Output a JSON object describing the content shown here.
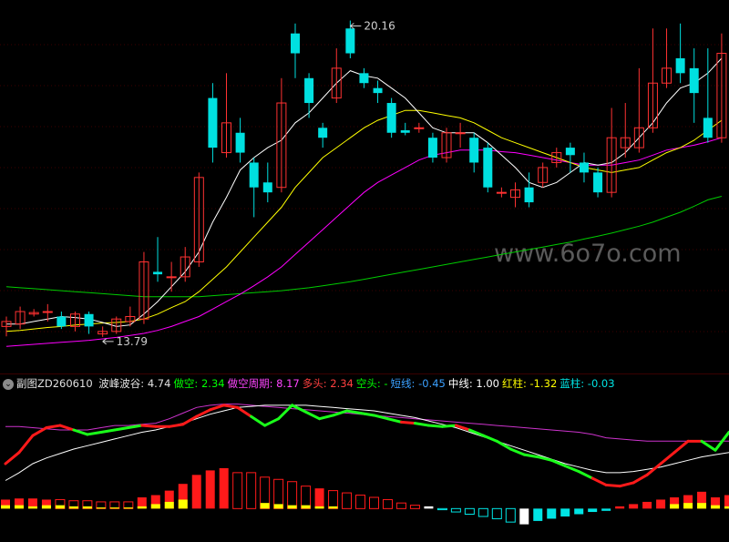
{
  "colors": {
    "up": "#ff3232",
    "down": "#00e0e0",
    "ma5": "#ffffff",
    "ma10": "#ffff00",
    "ma20": "#ff00ff",
    "ma60": "#00cc00",
    "red_bar": "#ff1a1a",
    "yellow_bar": "#ffff00",
    "cyan_bar": "#00e5e5",
    "white_bar": "#ffffff"
  },
  "main": {
    "high_label": "20.16",
    "low_label": "13.79",
    "watermark": "www.6o7o.com"
  },
  "indicator": {
    "title": "副图ZD260610",
    "fields": [
      {
        "label": "波峰波谷:",
        "value": "4.74",
        "color": "#e0e0e0"
      },
      {
        "label": "做空:",
        "value": "2.34",
        "color": "#00ff00"
      },
      {
        "label": "做空周期:",
        "value": "8.17",
        "color": "#ff44ff"
      },
      {
        "label": "多头:",
        "value": "2.34",
        "color": "#ff4040"
      },
      {
        "label": "空头:",
        "value": "-",
        "color": "#00ff00"
      },
      {
        "label": "短线:",
        "value": "-0.45",
        "color": "#3aa0ff"
      },
      {
        "label": "中线:",
        "value": "1.00",
        "color": "#ffffff"
      },
      {
        "label": "红柱:",
        "value": "-1.32",
        "color": "#ffff00"
      },
      {
        "label": "蓝柱:",
        "value": "-0.03",
        "color": "#00e5e5"
      }
    ]
  },
  "chart_data": [
    {
      "type": "candlestick",
      "ylim": [
        13.2,
        20.5
      ],
      "candles": [
        [
          14.0,
          14.1,
          14.2,
          13.8
        ],
        [
          14.05,
          14.3,
          14.4,
          13.95
        ],
        [
          14.25,
          14.28,
          14.35,
          14.2
        ],
        [
          14.3,
          14.3,
          14.45,
          14.1
        ],
        [
          14.2,
          14.0,
          14.3,
          13.95
        ],
        [
          14.0,
          14.25,
          14.3,
          13.9
        ],
        [
          14.25,
          14.0,
          14.3,
          13.85
        ],
        [
          13.85,
          13.9,
          14.0,
          13.79
        ],
        [
          13.9,
          14.15,
          14.2,
          13.85
        ],
        [
          14.1,
          14.2,
          14.4,
          14.0
        ],
        [
          14.15,
          15.3,
          15.5,
          14.05
        ],
        [
          15.1,
          15.05,
          15.8,
          14.9
        ],
        [
          15.0,
          15.0,
          15.3,
          14.7
        ],
        [
          15.0,
          15.4,
          15.6,
          14.9
        ],
        [
          15.3,
          17.0,
          17.1,
          15.2
        ],
        [
          18.6,
          17.6,
          18.9,
          17.3
        ],
        [
          17.5,
          18.1,
          19.1,
          17.4
        ],
        [
          17.9,
          17.5,
          18.2,
          17.3
        ],
        [
          17.3,
          16.8,
          17.4,
          16.2
        ],
        [
          16.9,
          16.7,
          17.3,
          16.5
        ],
        [
          16.8,
          18.5,
          19.0,
          16.7
        ],
        [
          19.9,
          19.5,
          20.1,
          19.0
        ],
        [
          19.0,
          18.5,
          19.1,
          18.2
        ],
        [
          18.0,
          17.8,
          18.1,
          17.6
        ],
        [
          18.6,
          19.2,
          19.6,
          18.5
        ],
        [
          20.0,
          19.5,
          20.16,
          19.4
        ],
        [
          19.1,
          18.9,
          19.2,
          18.8
        ],
        [
          18.8,
          18.7,
          18.95,
          18.5
        ],
        [
          18.5,
          17.9,
          18.6,
          17.8
        ],
        [
          17.95,
          17.9,
          18.1,
          17.85
        ],
        [
          18.0,
          18.0,
          18.1,
          17.9
        ],
        [
          17.8,
          17.4,
          17.9,
          17.3
        ],
        [
          17.4,
          17.9,
          18.0,
          17.3
        ],
        [
          17.9,
          17.9,
          18.1,
          17.6
        ],
        [
          17.8,
          17.3,
          17.9,
          17.1
        ],
        [
          17.6,
          16.8,
          17.7,
          16.7
        ],
        [
          16.7,
          16.7,
          16.8,
          16.6
        ],
        [
          16.6,
          16.75,
          16.9,
          16.4
        ],
        [
          16.8,
          16.5,
          17.1,
          16.4
        ],
        [
          16.9,
          17.2,
          17.3,
          16.8
        ],
        [
          17.3,
          17.5,
          17.6,
          17.2
        ],
        [
          17.6,
          17.45,
          17.7,
          17.1
        ],
        [
          17.3,
          17.1,
          17.5,
          16.9
        ],
        [
          17.1,
          16.7,
          17.2,
          16.6
        ],
        [
          16.7,
          17.8,
          18.4,
          16.6
        ],
        [
          17.6,
          17.8,
          18.5,
          17.4
        ],
        [
          17.6,
          18.0,
          19.2,
          17.5
        ],
        [
          18.0,
          18.9,
          20.0,
          17.9
        ],
        [
          18.9,
          19.2,
          20.0,
          18.8
        ],
        [
          19.4,
          19.1,
          20.1,
          18.9
        ],
        [
          19.2,
          18.7,
          19.6,
          18.1
        ],
        [
          18.2,
          17.8,
          19.6,
          17.7
        ],
        [
          17.8,
          19.5,
          19.9,
          17.7
        ]
      ],
      "ma5": [
        14.05,
        14.05,
        14.1,
        14.15,
        14.2,
        14.18,
        14.15,
        14.08,
        14.0,
        14.03,
        14.25,
        14.5,
        14.8,
        15.1,
        15.5,
        16.1,
        16.6,
        17.15,
        17.4,
        17.6,
        17.75,
        18.1,
        18.3,
        18.6,
        18.9,
        19.15,
        19.05,
        19.0,
        18.8,
        18.6,
        18.3,
        18.0,
        17.9,
        17.9,
        17.9,
        17.7,
        17.45,
        17.2,
        16.9,
        16.8,
        16.9,
        17.1,
        17.3,
        17.25,
        17.3,
        17.5,
        17.8,
        18.1,
        18.5,
        18.8,
        18.9,
        19.1,
        19.4
      ],
      "ma10": [
        13.9,
        13.92,
        13.95,
        13.98,
        14.0,
        14.03,
        14.05,
        14.07,
        14.08,
        14.1,
        14.15,
        14.25,
        14.38,
        14.5,
        14.7,
        14.95,
        15.2,
        15.5,
        15.8,
        16.1,
        16.4,
        16.8,
        17.1,
        17.4,
        17.6,
        17.8,
        18.0,
        18.15,
        18.25,
        18.35,
        18.35,
        18.3,
        18.25,
        18.2,
        18.1,
        17.95,
        17.8,
        17.7,
        17.6,
        17.5,
        17.4,
        17.3,
        17.2,
        17.15,
        17.1,
        17.15,
        17.2,
        17.35,
        17.5,
        17.6,
        17.75,
        17.95,
        18.15
      ],
      "ma20": [
        13.6,
        13.62,
        13.64,
        13.66,
        13.68,
        13.7,
        13.72,
        13.75,
        13.78,
        13.82,
        13.86,
        13.92,
        14.0,
        14.1,
        14.2,
        14.35,
        14.5,
        14.65,
        14.82,
        15.0,
        15.2,
        15.45,
        15.7,
        15.95,
        16.2,
        16.45,
        16.7,
        16.9,
        17.05,
        17.2,
        17.35,
        17.45,
        17.5,
        17.55,
        17.55,
        17.55,
        17.52,
        17.5,
        17.45,
        17.4,
        17.35,
        17.3,
        17.25,
        17.25,
        17.25,
        17.3,
        17.35,
        17.45,
        17.55,
        17.6,
        17.65,
        17.72,
        17.8
      ],
      "ma60": [
        14.8,
        14.78,
        14.76,
        14.74,
        14.72,
        14.7,
        14.68,
        14.66,
        14.64,
        14.62,
        14.6,
        14.6,
        14.6,
        14.6,
        14.6,
        14.62,
        14.64,
        14.66,
        14.68,
        14.7,
        14.72,
        14.75,
        14.78,
        14.82,
        14.86,
        14.9,
        14.95,
        15.0,
        15.05,
        15.1,
        15.15,
        15.2,
        15.25,
        15.3,
        15.35,
        15.4,
        15.45,
        15.5,
        15.55,
        15.6,
        15.65,
        15.7,
        15.76,
        15.82,
        15.88,
        15.95,
        16.02,
        16.1,
        16.2,
        16.3,
        16.42,
        16.55,
        16.62
      ]
    },
    {
      "type": "line",
      "ylim": [
        -2,
        10
      ],
      "peak_line": [
        4.0,
        5.0,
        6.5,
        7.2,
        7.4,
        7.0,
        6.6,
        6.8,
        7.0,
        7.2,
        7.4,
        7.3,
        7.3,
        7.5,
        8.2,
        8.8,
        9.2,
        9.0,
        8.2,
        7.4,
        8.0,
        9.2,
        8.6,
        8.0,
        8.3,
        8.7,
        8.5,
        8.3,
        8.0,
        7.7,
        7.6,
        7.4,
        7.3,
        7.4,
        7.0,
        6.5,
        6.0,
        5.3,
        4.8,
        4.6,
        4.3,
        3.8,
        3.3,
        2.7,
        2.1,
        2.0,
        2.3,
        3.0,
        4.0,
        5.0,
        6.0,
        6.0,
        5.2,
        6.8
      ],
      "peak_color": [
        "r",
        "r",
        "r",
        "r",
        "r",
        "g",
        "g",
        "g",
        "g",
        "g",
        "r",
        "r",
        "r",
        "r",
        "r",
        "r",
        "r",
        "r",
        "g",
        "g",
        "g",
        "g",
        "g",
        "g",
        "g",
        "g",
        "g",
        "g",
        "g",
        "r",
        "g",
        "g",
        "g",
        "r",
        "g",
        "g",
        "g",
        "g",
        "g",
        "g",
        "g",
        "g",
        "g",
        "r",
        "r",
        "r",
        "r",
        "r",
        "r",
        "r",
        "r",
        "g",
        "g",
        "g"
      ],
      "short_cycle": [
        7.3,
        7.3,
        7.2,
        7.1,
        7.0,
        7.0,
        7.0,
        7.2,
        7.4,
        7.4,
        7.5,
        7.6,
        8.0,
        8.5,
        9.0,
        9.2,
        9.3,
        9.3,
        9.2,
        9.1,
        9.0,
        8.9,
        8.8,
        8.7,
        8.6,
        8.5,
        8.4,
        8.3,
        8.2,
        8.1,
        8.0,
        7.9,
        7.8,
        7.7,
        7.6,
        7.5,
        7.4,
        7.3,
        7.2,
        7.1,
        7.0,
        6.9,
        6.8,
        6.6,
        6.3,
        6.2,
        6.1,
        6.0,
        6.0,
        6.0,
        6.0,
        6.0,
        6.0,
        6.0
      ],
      "mid_line": [
        2.5,
        3.2,
        4.0,
        4.5,
        4.9,
        5.3,
        5.6,
        5.9,
        6.2,
        6.5,
        6.8,
        7.0,
        7.3,
        7.6,
        8.0,
        8.4,
        8.7,
        9.0,
        9.1,
        9.2,
        9.2,
        9.2,
        9.2,
        9.1,
        9.0,
        8.9,
        8.8,
        8.7,
        8.5,
        8.3,
        8.1,
        7.8,
        7.5,
        7.2,
        6.8,
        6.4,
        6.0,
        5.6,
        5.2,
        4.8,
        4.4,
        4.0,
        3.7,
        3.4,
        3.2,
        3.2,
        3.3,
        3.5,
        3.7,
        4.0,
        4.3,
        4.6,
        4.8,
        5.0
      ],
      "bars": [
        0.8,
        0.9,
        0.9,
        0.8,
        0.8,
        0.7,
        0.7,
        0.6,
        0.6,
        0.6,
        1.0,
        1.2,
        1.6,
        2.2,
        3.0,
        3.4,
        3.6,
        3.2,
        3.2,
        2.8,
        2.6,
        2.4,
        2.0,
        1.8,
        1.6,
        1.4,
        1.2,
        1.0,
        0.8,
        0.5,
        0.3,
        0.2,
        -0.1,
        -0.3,
        -0.5,
        -0.7,
        -0.9,
        -1.2,
        -1.4,
        -1.1,
        -0.9,
        -0.7,
        -0.5,
        -0.3,
        -0.2,
        0.2,
        0.4,
        0.6,
        0.8,
        1.0,
        1.2,
        1.5,
        1.0,
        1.2
      ],
      "bar_style": [
        "rf",
        "rf",
        "rf",
        "rf",
        "rh",
        "rh",
        "rh",
        "rh",
        "rh",
        "rh",
        "rf",
        "rf",
        "rf",
        "rf",
        "rf",
        "rf",
        "rf",
        "rh",
        "rh",
        "rh",
        "rh",
        "rh",
        "rh",
        "rf",
        "rh",
        "rh",
        "rh",
        "rh",
        "rh",
        "rh",
        "rh",
        "wf",
        "ch",
        "ch",
        "ch",
        "ch",
        "ch",
        "ch",
        "wf",
        "cf",
        "cf",
        "cf",
        "cf",
        "cf",
        "cf",
        "rf",
        "rf",
        "rf",
        "rf",
        "rf",
        "rf",
        "rf",
        "rf",
        "rf"
      ],
      "yellow_inner": [
        0.3,
        0.3,
        0.2,
        0.3,
        0.3,
        0.2,
        0.2,
        0.1,
        0.1,
        0.1,
        0.2,
        0.4,
        0.6,
        0.8,
        0,
        0,
        0,
        0,
        0,
        0.5,
        0.4,
        0.3,
        0.3,
        0.2,
        0.2,
        0,
        0,
        0,
        0,
        0,
        0,
        0,
        0,
        0,
        0,
        0,
        0,
        0,
        0,
        0,
        0,
        0,
        0,
        0,
        0,
        0,
        0,
        0,
        0,
        0.4,
        0.5,
        0.5,
        0.3,
        0.2
      ]
    }
  ]
}
